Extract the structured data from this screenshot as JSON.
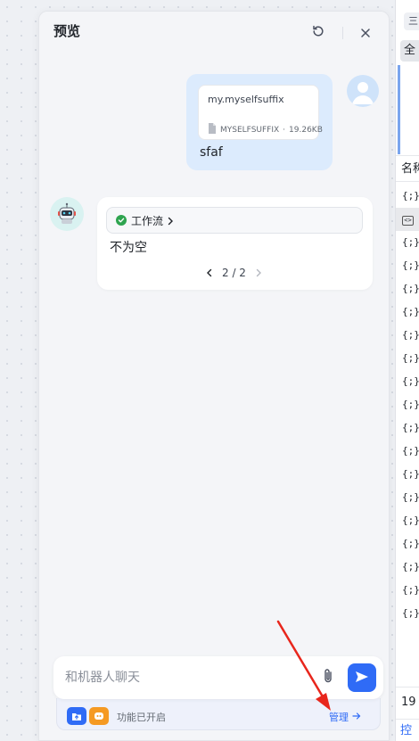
{
  "preview": {
    "title": "预览"
  },
  "user_message": {
    "file": {
      "name": "my.myselfsuffix",
      "type": "MYSELFSUFFIX",
      "separator": "·",
      "size": "19.26KB"
    },
    "text": "sfaf"
  },
  "bot_message": {
    "workflow_label": "工作流",
    "text": "不为空",
    "pager": "2 / 2"
  },
  "composer": {
    "placeholder": "和机器人聊天",
    "features_text": "功能已开启",
    "manage_label": "管理"
  },
  "right_panel": {
    "top_tab": "三",
    "all_label": "全",
    "column_header": "名称",
    "row_glyph": "{;}",
    "selected_glyph": "<>",
    "footer_number": "19",
    "footer_link": "控"
  },
  "colors": {
    "accent": "#2f6bf6",
    "user_bubble": "#dcebfd",
    "success": "#2ea44f",
    "annotation": "#e8261c"
  },
  "icons": {
    "refresh": "refresh-icon",
    "close": "close-icon",
    "file": "file-icon",
    "check": "check-circle-icon",
    "attach": "paperclip-icon",
    "send": "send-icon"
  }
}
